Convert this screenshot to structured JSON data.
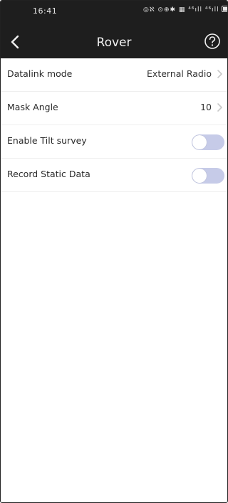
{
  "status_bar": {
    "time": "16:41",
    "icons_text": "◎ℵ ⊙⊕✱ ▦ ⁴⁶ıll ⁴⁶ıll",
    "icons": [
      "notification-icon",
      "nfc-icon",
      "alarm-icon",
      "location-icon",
      "bluetooth-icon",
      "hd-icon",
      "signal-icon",
      "signal-icon",
      "battery-icon"
    ]
  },
  "header": {
    "title": "Rover",
    "back_icon": "chevron-left-icon",
    "help_icon": "help-circle-icon"
  },
  "settings": {
    "datalink": {
      "label": "Datalink mode",
      "value": "External Radio"
    },
    "mask_angle": {
      "label": "Mask Angle",
      "value": "10"
    },
    "tilt_survey": {
      "label": "Enable Tilt survey",
      "enabled": false
    },
    "static_data": {
      "label": "Record Static Data",
      "enabled": false
    }
  },
  "colors": {
    "header_bg": "#1e1e1e",
    "toggle_off_track": "#c6cbe8",
    "chevron": "#c8c8c8"
  }
}
